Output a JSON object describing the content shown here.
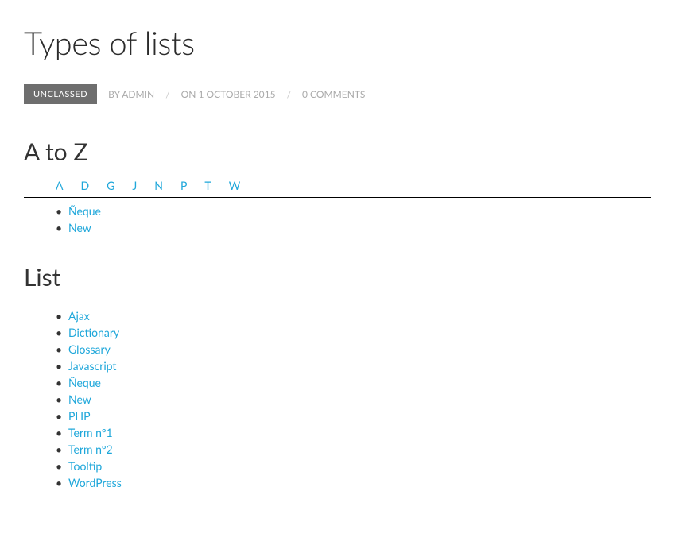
{
  "title": "Types of lists",
  "meta": {
    "category": "UNCLASSED",
    "by_label": "BY",
    "author": "ADMIN",
    "on_label": "ON",
    "date": "1 OCTOBER 2015",
    "comments": "0 COMMENTS"
  },
  "atoz": {
    "heading": "A to Z",
    "letters": [
      {
        "label": "A",
        "active": false
      },
      {
        "label": "D",
        "active": false
      },
      {
        "label": "G",
        "active": false
      },
      {
        "label": "J",
        "active": false
      },
      {
        "label": "N",
        "active": true
      },
      {
        "label": "P",
        "active": false
      },
      {
        "label": "T",
        "active": false
      },
      {
        "label": "W",
        "active": false
      }
    ],
    "items": [
      "Ñeque",
      "New"
    ]
  },
  "list": {
    "heading": "List",
    "items": [
      "Ajax",
      "Dictionary",
      "Glossary",
      "Javascript",
      "Ñeque",
      "New",
      "PHP",
      "Term nº1",
      "Term nº2",
      "Tooltip",
      "WordPress"
    ]
  }
}
